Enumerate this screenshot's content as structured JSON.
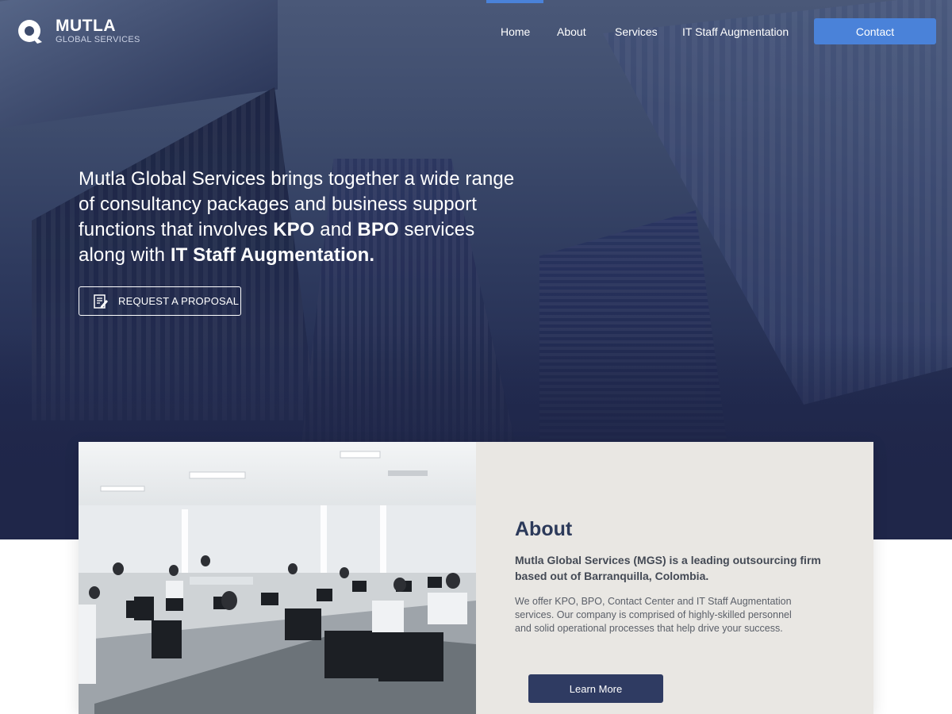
{
  "brand": {
    "name": "MUTLA",
    "tagline": "GLOBAL SERVICES"
  },
  "nav": {
    "home": "Home",
    "about": "About",
    "services": "Services",
    "staff": "IT Staff Augmentation",
    "contact": "Contact",
    "active_indicator_color": "#4a82d9"
  },
  "hero": {
    "line_parts": [
      "Mutla Global Services brings together a wide range of consultancy packages and business support functions that involves ",
      "KPO",
      " and ",
      "BPO",
      " services along with ",
      "IT Staff Augmentation."
    ],
    "cta": "REQUEST A PROPOSAL",
    "cta_icon": "edit-document-icon"
  },
  "about": {
    "title": "About",
    "lead": "Mutla Global Services (MGS) is a leading outsourcing firm based out of Barranquilla, Colombia.",
    "body": "We offer KPO, BPO, Contact Center and IT Staff Augmentation services. Our company is comprised of highly-skilled personnel and solid operational processes that help drive your success.",
    "button": "Learn More",
    "image": "office-workspace-photo"
  },
  "colors": {
    "accent": "#4a82d9",
    "hero_dark": "#1f2649",
    "button_dark": "#2f3b62",
    "panel": "#e9e7e3",
    "heading": "#2c3a5a"
  }
}
